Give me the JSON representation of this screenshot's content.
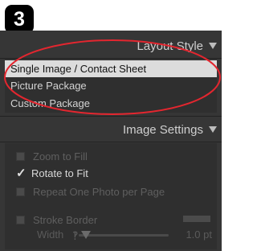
{
  "step_number": "3",
  "layout_style": {
    "title": "Layout Style",
    "items": [
      {
        "label": "Single Image / Contact Sheet",
        "selected": true
      },
      {
        "label": "Picture Package",
        "selected": false
      },
      {
        "label": "Custom Package",
        "selected": false
      }
    ]
  },
  "image_settings": {
    "title": "Image Settings",
    "options": [
      {
        "label": "Zoom to Fill",
        "checked": false,
        "enabled": false
      },
      {
        "label": "Rotate to Fit",
        "checked": true,
        "enabled": true
      },
      {
        "label": "Repeat One Photo per Page",
        "checked": false,
        "enabled": false
      }
    ],
    "stroke_border": {
      "label": "Stroke Border",
      "checked": false,
      "enabled": false
    },
    "width": {
      "label": "Width",
      "value_text": "1.0",
      "unit": "pt",
      "slider_fraction": 0.08
    }
  },
  "colors": {
    "panel": "#363636",
    "selection": "#dcdcdc",
    "annotation": "#e3262f"
  },
  "icons": {
    "header_toggle": "triangle-down-icon",
    "checkmark": "checkmark-icon"
  }
}
